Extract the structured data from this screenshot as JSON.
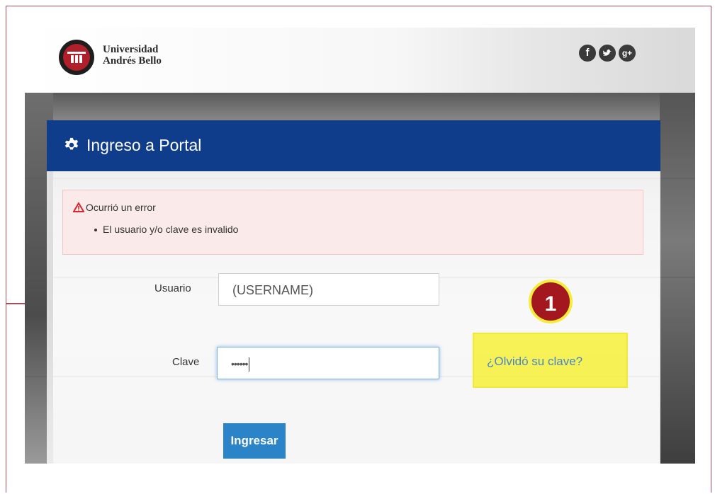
{
  "brand": {
    "name_line1": "Universidad",
    "name_line2": "Andrés Bello",
    "social_icons": [
      "facebook-icon",
      "twitter-icon",
      "google-plus-icon"
    ]
  },
  "panel": {
    "title": "Ingreso a Portal",
    "header_color": "#0f3d8c"
  },
  "alert": {
    "title": "Ocurrió un error",
    "messages": [
      "El usuario y/o clave es invalido"
    ]
  },
  "form": {
    "username_label": "Usuario",
    "username_value": "(USERNAME)",
    "password_label": "Clave",
    "password_value": "••••••",
    "forgot_link": "¿Olvidó su clave?",
    "submit_label": "Ingresar"
  },
  "annotation": {
    "step_number": "1",
    "badge_color": "#a4171e",
    "highlight_color": "#f6ef28"
  }
}
